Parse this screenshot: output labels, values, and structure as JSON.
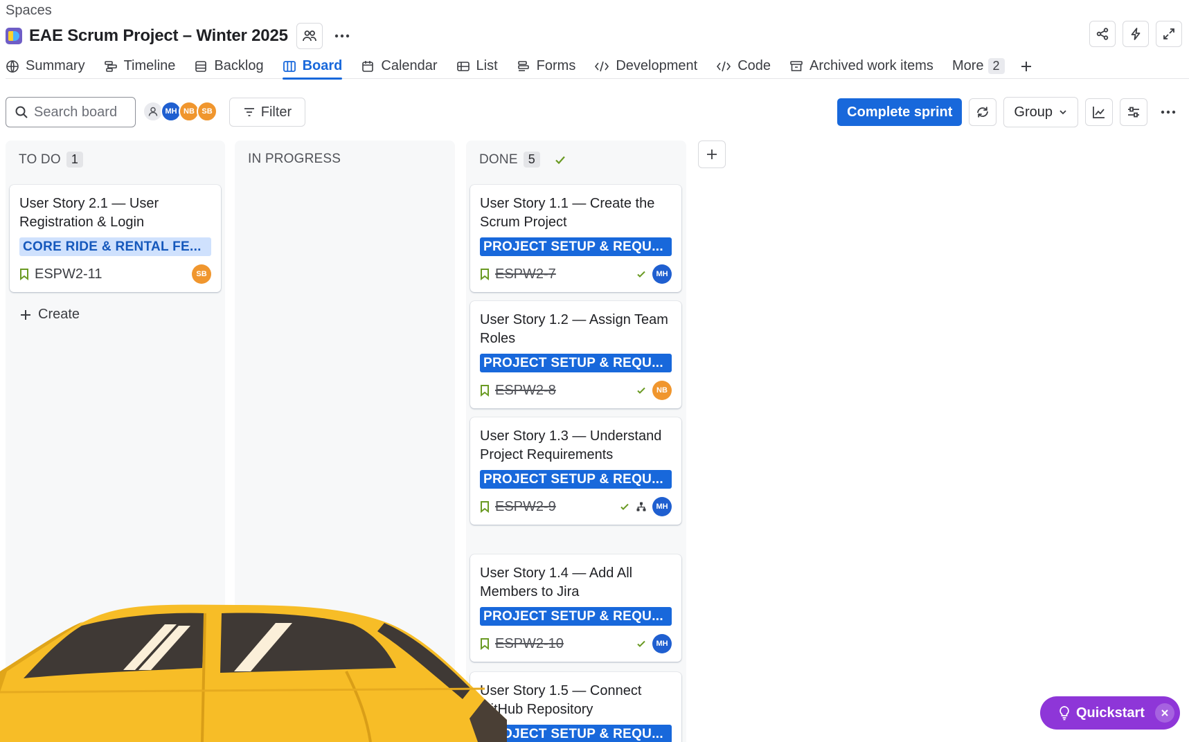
{
  "header": {
    "breadcrumb": "Spaces",
    "project_title": "EAE Scrum Project – Winter 2025"
  },
  "tabs": [
    {
      "label": "Summary",
      "icon": "globe-icon"
    },
    {
      "label": "Timeline",
      "icon": "timeline-icon"
    },
    {
      "label": "Backlog",
      "icon": "backlog-icon"
    },
    {
      "label": "Board",
      "icon": "board-icon",
      "active": true
    },
    {
      "label": "Calendar",
      "icon": "calendar-icon"
    },
    {
      "label": "List",
      "icon": "list-icon"
    },
    {
      "label": "Forms",
      "icon": "forms-icon"
    },
    {
      "label": "Development",
      "icon": "development-icon"
    },
    {
      "label": "Code",
      "icon": "code-icon"
    },
    {
      "label": "Archived work items",
      "icon": "archive-icon"
    }
  ],
  "more_tab": {
    "label": "More",
    "count": "2"
  },
  "toolbar": {
    "search_placeholder": "Search board",
    "filter_label": "Filter",
    "complete_label": "Complete sprint",
    "group_label": "Group",
    "avatars": [
      "MH",
      "NB",
      "SB"
    ]
  },
  "columns": {
    "todo": {
      "name": "TO DO",
      "count": "1",
      "create_label": "Create",
      "cards": [
        {
          "title": "User Story 2.1 — User Registration & Login",
          "epic": "CORE RIDE & RENTAL FE...",
          "key": "ESPW2-11",
          "assignee": "SB"
        }
      ]
    },
    "in_progress": {
      "name": "IN PROGRESS"
    },
    "done": {
      "name": "DONE",
      "count": "5",
      "cards": [
        {
          "title": "User Story 1.1 — Create the Scrum Project",
          "epic": "PROJECT SETUP & REQU...",
          "key": "ESPW2-7",
          "assignee": "MH"
        },
        {
          "title": "User Story 1.2 — Assign Team Roles",
          "epic": "PROJECT SETUP & REQU...",
          "key": "ESPW2-8",
          "assignee": "NB"
        },
        {
          "title": "User Story 1.3 — Understand Project Requirements",
          "epic": "PROJECT SETUP & REQU...",
          "key": "ESPW2-9",
          "assignee": "MH"
        },
        {
          "title": "User Story 1.4 — Add All Members to Jira",
          "epic": "PROJECT SETUP & REQU...",
          "key": "ESPW2-10",
          "assignee": "MH"
        },
        {
          "title": "User Story 1.5 — Connect GitHub Repository",
          "epic": "PROJECT SETUP & REQU..."
        }
      ]
    }
  },
  "quickstart": {
    "label": "Quickstart"
  },
  "colors": {
    "brand_blue": "#1868db",
    "epic_light_bg": "#cfe1fd",
    "done_green": "#6a9a23",
    "quickstart_purple": "#8e36d8",
    "avatar_mh": "#1f5fd0",
    "avatar_orange": "#f0962e"
  }
}
